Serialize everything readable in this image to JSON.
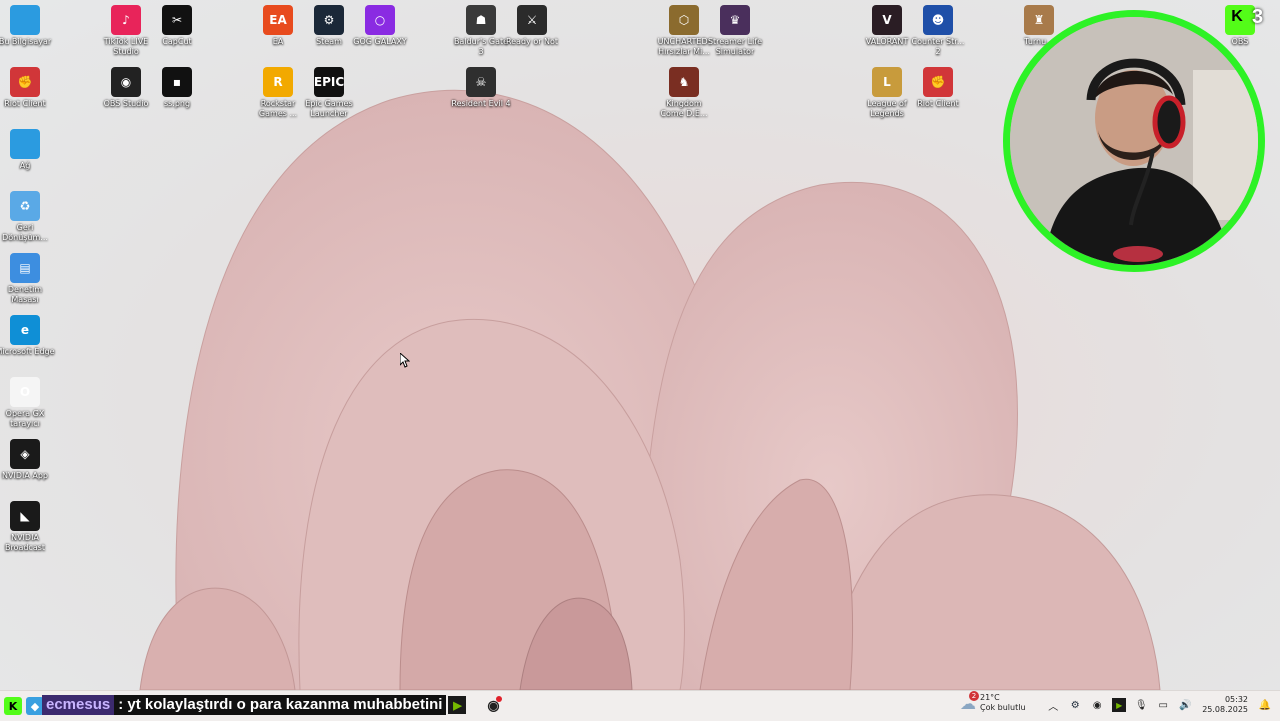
{
  "desktop": {
    "icons": [
      {
        "label": "Bu Bilgisayar",
        "icon": "computer-icon",
        "color": "#2b9be0",
        "glyph": ""
      },
      {
        "label": "TikTok LIVE Studio",
        "icon": "tiktok-icon",
        "color": "#e8245a",
        "glyph": "♪"
      },
      {
        "label": "CapCut",
        "icon": "capcut-icon",
        "color": "#111111",
        "glyph": "✂"
      },
      {
        "label": "EA",
        "icon": "ea-icon",
        "color": "#e84b1e",
        "glyph": "EA"
      },
      {
        "label": "Steam",
        "icon": "steam-icon",
        "color": "#1b2838",
        "glyph": "⚙"
      },
      {
        "label": "GOG GALAXY",
        "icon": "gog-icon",
        "color": "#8a2be2",
        "glyph": "○"
      },
      {
        "label": "Baldur's Gate 3",
        "icon": "baldurs-gate-icon",
        "color": "#3a3a3a",
        "glyph": "☗"
      },
      {
        "label": "Ready or Not",
        "icon": "ready-or-not-icon",
        "color": "#2b2b2b",
        "glyph": "⚔"
      },
      {
        "label": "UNCHARTED: Hırsızlar Mi...",
        "icon": "uncharted-icon",
        "color": "#8b6b2e",
        "glyph": "⬡"
      },
      {
        "label": "Streamer Life Simulator",
        "icon": "streamer-life-icon",
        "color": "#4a2f5c",
        "glyph": "♛"
      },
      {
        "label": "VALORANT",
        "icon": "valorant-icon",
        "color": "#2a1d24",
        "glyph": "V"
      },
      {
        "label": "Counter Str... 2",
        "icon": "counter-strike-icon",
        "color": "#1f4fa8",
        "glyph": "☻"
      },
      {
        "label": "Turnu...",
        "icon": "turnu-icon",
        "color": "#a87a4a",
        "glyph": "♜"
      },
      {
        "label": "OBS",
        "icon": "kick-icon",
        "color": "#53fc18",
        "glyph": "K"
      },
      {
        "label": "Riot Client",
        "icon": "riot-client-icon",
        "color": "#d13639",
        "glyph": "✊"
      },
      {
        "label": "OBS Studio",
        "icon": "obs-icon",
        "color": "#222222",
        "glyph": "◉"
      },
      {
        "label": "ss.png",
        "icon": "image-file-icon",
        "color": "#111111",
        "glyph": "▪"
      },
      {
        "label": "Rockstar Games ...",
        "icon": "rockstar-icon",
        "color": "#f2a900",
        "glyph": "R"
      },
      {
        "label": "Epic Games Launcher",
        "icon": "epic-games-icon",
        "color": "#111111",
        "glyph": "EPIC"
      },
      {
        "label": "Resident Evil 4",
        "icon": "resident-evil-icon",
        "color": "#2f2f2f",
        "glyph": "☠"
      },
      {
        "label": "Kingdom Come D.E...",
        "icon": "kingdom-come-icon",
        "color": "#7a2e22",
        "glyph": "♞"
      },
      {
        "label": "League of Legends",
        "icon": "league-icon",
        "color": "#c89b3c",
        "glyph": "L"
      },
      {
        "label": "Riot Client",
        "icon": "riot-client-icon",
        "color": "#d13639",
        "glyph": "✊"
      },
      {
        "label": "Ağ",
        "icon": "network-icon",
        "color": "#2b9be0",
        "glyph": ""
      },
      {
        "label": "Geri Dönüşüm...",
        "icon": "recycle-bin-icon",
        "color": "#5aa9e6",
        "glyph": "♻"
      },
      {
        "label": "Denetim Masası",
        "icon": "control-panel-icon",
        "color": "#3d8ee0",
        "glyph": "▤"
      },
      {
        "label": "Microsoft Edge",
        "icon": "edge-icon",
        "color": "#0f8fd6",
        "glyph": "e"
      },
      {
        "label": "Opera GX tarayıcı",
        "icon": "opera-gx-icon",
        "color": "#f5f5f5",
        "glyph": "O"
      },
      {
        "label": "NVIDIA App",
        "icon": "nvidia-icon",
        "color": "#1a1a1a",
        "glyph": "◈"
      },
      {
        "label": "NVIDIA Broadcast",
        "icon": "nvidia-broadcast-icon",
        "color": "#1a1a1a",
        "glyph": "◣"
      }
    ]
  },
  "overlay": {
    "notification_count": "3",
    "chat_user": "ecmesus",
    "chat_message": ": yt kolaylaştırdı o para kazanma muhabbetini"
  },
  "taskbar": {
    "weather_temp": "21°C",
    "weather_desc": "Çok bulutlu",
    "weather_badge": "2",
    "time": "05:32",
    "date": "25.08.2025"
  },
  "colors": {
    "webcam_border": "#2df226",
    "kick_green": "#53fc18"
  }
}
